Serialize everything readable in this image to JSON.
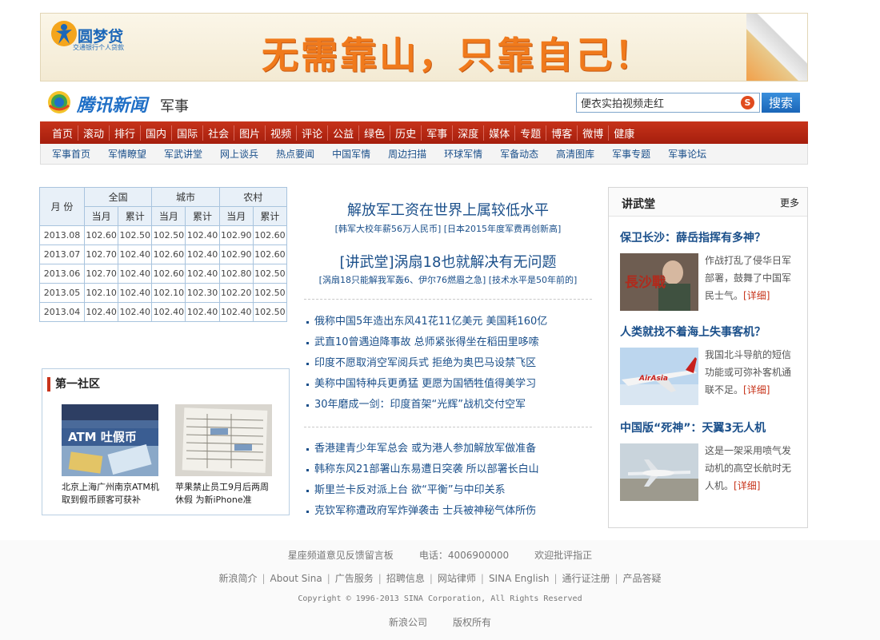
{
  "banner": {
    "brand": "圆梦贷",
    "brand_sub": "交通银行个人贷款",
    "slogan": "无需靠山，只靠自己！"
  },
  "header": {
    "site_name": "腾讯新闻",
    "channel": "军事",
    "search_value": "便衣实拍视频走红",
    "search_button": "搜索"
  },
  "main_nav": [
    "首页",
    "滚动",
    "排行",
    "国内",
    "国际",
    "社会",
    "图片",
    "视频",
    "评论",
    "公益",
    "绿色",
    "历史",
    "军事",
    "深度",
    "媒体",
    "专题",
    "博客",
    "微博",
    "健康"
  ],
  "sub_nav": [
    "军事首页",
    "军情瞭望",
    "军武讲堂",
    "网上谈兵",
    "热点要闻",
    "中国军情",
    "周边扫描",
    "环球军情",
    "军备动态",
    "高清图库",
    "军事专题",
    "军事论坛"
  ],
  "table": {
    "month_label": "月 份",
    "groups": [
      "全国",
      "城市",
      "农村"
    ],
    "sub_headers": [
      "当月",
      "累计",
      "当月",
      "累计",
      "当月",
      "累计"
    ],
    "rows": [
      [
        "2013.08",
        "102.60",
        "102.50",
        "102.50",
        "102.40",
        "102.90",
        "102.60"
      ],
      [
        "2013.07",
        "102.70",
        "102.40",
        "102.60",
        "102.40",
        "102.90",
        "102.60"
      ],
      [
        "2013.06",
        "102.70",
        "102.40",
        "102.60",
        "102.40",
        "102.80",
        "102.50"
      ],
      [
        "2013.05",
        "102.10",
        "102.40",
        "102.10",
        "102.30",
        "102.20",
        "102.50"
      ],
      [
        "2013.04",
        "102.40",
        "102.40",
        "102.40",
        "102.40",
        "102.40",
        "102.50"
      ]
    ]
  },
  "community": {
    "title": "第一社区",
    "items": [
      {
        "caption": "北京上海广州南京ATM机取到假币顾客可获补",
        "photo_text": "ATM 吐假币"
      },
      {
        "caption": "苹果禁止员工9月后两周休假 为新iPhone准"
      }
    ]
  },
  "headlines": [
    {
      "title": "解放军工资在世界上属较低水平",
      "links": "[韩军大校年薪56万人民币] [日本2015年度军费再创新高]"
    },
    {
      "title": "[讲武堂]涡扇18也就解决有无问题",
      "links": "[涡扇18只能解我军轰6、伊尔76燃眉之急] [技术水平是50年前的]"
    }
  ],
  "news_list_1": [
    "俄称中国5年造出东风41花11亿美元 美国耗160亿",
    "武直10曾遇迫降事故 总师紧张得坐在稻田里哆嗦",
    "印度不愿取消空军阅兵式 拒绝为奥巴马设禁飞区",
    "美称中国特种兵更勇猛 更愿为国牺牲值得美学习",
    "30年磨成一剑：印度首架“光辉”战机交付空军"
  ],
  "news_list_2": [
    "香港建青少年军总会 或为港人参加解放军做准备",
    "韩称东风21部署山东易遭日突袭 所以部署长白山",
    "斯里兰卡反对派上台 欲“平衡”与中印关系",
    "克钦军称遭政府军炸弹袭击 士兵被神秘气体所伤"
  ],
  "right_col": {
    "title": "讲武堂",
    "more": "更多",
    "items": [
      {
        "title": "保卫长沙：薛岳指挥有多神？",
        "text": "作战打乱了侵华日军部署，鼓舞了中国军民士气。",
        "more": "[详细]",
        "thumb_text": "長沙戰"
      },
      {
        "title": "人类就找不着海上失事客机？",
        "text": "我国北斗导航的短信功能或可弥补客机通联不足。",
        "more": "[详细]",
        "thumb_text": "AirAsia"
      },
      {
        "title": "中国版“死神”：天翼3无人机",
        "text": "这是一架采用喷气发动机的高空长航时无人机。",
        "more": "[详细]"
      }
    ]
  },
  "footer": {
    "row1": [
      "星座频道意见反馈留言板",
      "电话：4006900000",
      "欢迎批评指正"
    ],
    "row2": [
      "新浪简介",
      "About Sina",
      "广告服务",
      "招聘信息",
      "网站律师",
      "SINA English",
      "通行证注册",
      "产品答疑"
    ],
    "copyright": "Copyright © 1996-2013 SINA Corporation, All Rights Reserved",
    "row4": [
      "新浪公司",
      "版权所有"
    ]
  },
  "colors": {
    "nav_red": "#b52714",
    "link_blue": "#1a4f8a",
    "search_blue": "#1f6fc6"
  }
}
